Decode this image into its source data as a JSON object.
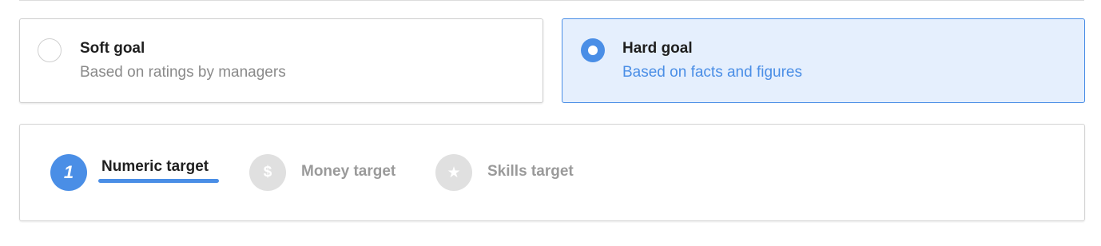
{
  "goal_types": [
    {
      "title": "Soft goal",
      "description": "Based on ratings by managers",
      "selected": false
    },
    {
      "title": "Hard goal",
      "description": "Based on facts and figures",
      "selected": true
    }
  ],
  "targets": {
    "active_step": 1,
    "steps": [
      {
        "badge": "1",
        "label": "Numeric target",
        "icon": "number-one-icon",
        "active": true
      },
      {
        "badge": "$",
        "label": "Money target",
        "icon": "dollar-icon",
        "active": false
      },
      {
        "badge": "★",
        "label": "Skills target",
        "icon": "star-icon",
        "active": false
      }
    ]
  },
  "colors": {
    "accent": "#4a8ee6",
    "selected_card_bg": "#e5effd",
    "muted_text": "#8a8a8a",
    "inactive_badge": "#e0e0e0"
  }
}
